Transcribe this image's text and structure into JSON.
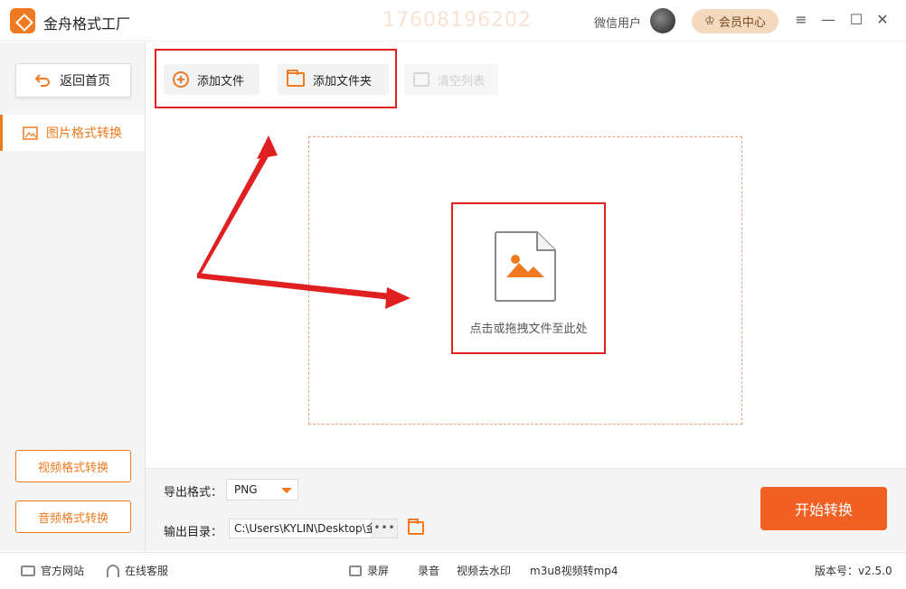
{
  "app": {
    "title": "金舟格式工厂",
    "watermark": "17608196202",
    "user_name": "微信用户",
    "vip_label": "会员中心",
    "accent_color": "#f07a22",
    "highlight_color": "#e02020"
  },
  "window_controls": {
    "menu": "≡",
    "minimize": "—",
    "maximize": "☐",
    "close": "✕"
  },
  "sidebar": {
    "home_label": "返回首页",
    "active_item": "图片格式转换",
    "bottom_buttons": [
      "视频格式转换",
      "音频格式转换"
    ]
  },
  "toolbar": {
    "add_file": "添加文件",
    "add_folder": "添加文件夹",
    "clear_list": "清空列表"
  },
  "drop_zone": {
    "hint": "点击或拖拽文件至此处"
  },
  "output": {
    "format_label": "导出格式：",
    "format_value": "PNG",
    "dir_label": "输出目录：",
    "dir_value": "C:\\Users\\KYLIN\\Desktop\\金",
    "more_label": "•••",
    "start_label": "开始转换"
  },
  "statusbar": {
    "website": "官方网站",
    "service": "在线客服",
    "record_screen": "录屏",
    "record_audio": "录音",
    "remove_watermark": "视频去水印",
    "m3u8": "m3u8视频转mp4",
    "version": "版本号：v2.5.0"
  }
}
